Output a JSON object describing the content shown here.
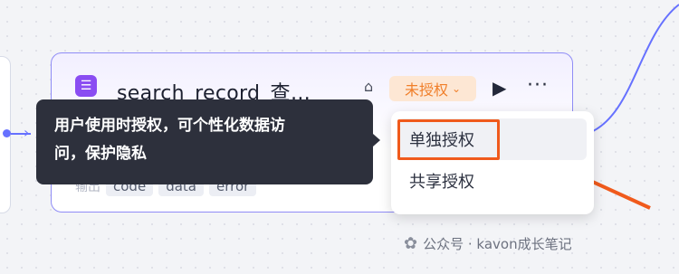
{
  "node": {
    "title": "search_record_查…",
    "auth_status": "未授权",
    "output_label": "输出",
    "outputs": [
      "code",
      "data",
      "error"
    ]
  },
  "tooltip": {
    "line1": "用户使用时授权，可个性化数据访",
    "line2": "问，保护隐私"
  },
  "menu": {
    "items": [
      "单独授权",
      "共享授权"
    ]
  },
  "watermark": "公众号 · kavon成长笔记",
  "colors": {
    "accent": "#6671ff",
    "node_border": "#8f8cf6",
    "badge_bg": "#fde7d4",
    "badge_text": "#f07f2a",
    "annotation": "#f05a1c",
    "tooltip_bg": "#2d303c"
  }
}
